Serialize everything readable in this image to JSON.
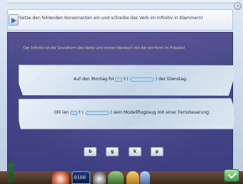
{
  "header": {
    "instruction": "Setze den fehlenden Konsonanten ein und schreibe das Verb im Infinitiv in Klammern!"
  },
  "main": {
    "definition": "Der Infinitiv ist die Grundform des Verbs und immer identisch mit der wir-Form im Präsens!",
    "sentences": [
      {
        "part1": "Auf den Montag fol",
        "part2": "t (",
        "part3": ") der Dienstag."
      },
      {
        "part1": "Olli len",
        "part2": "t (",
        "part3": ") sein Modellflugzeug mit einer Fernsteuerung."
      }
    ]
  },
  "letters": [
    "b",
    "g",
    "k",
    "p"
  ],
  "toolbar": {
    "score_display": "0100"
  },
  "icons": {
    "top": "play-arrow-icon",
    "close": "close-icon",
    "bottle": "bottle-icon",
    "back": "back-arrow-icon",
    "clock": "clock-icon",
    "book": "book-icon",
    "lamp": "lamp-icon",
    "pencil": "pencil-icon",
    "ok": "checkmark-icon"
  },
  "colors": {
    "panel": "#3f3d8c",
    "definition_text": "#e9c9a0",
    "blank_fill": "#b9d8f1",
    "ok_green": "#3c9a44"
  }
}
